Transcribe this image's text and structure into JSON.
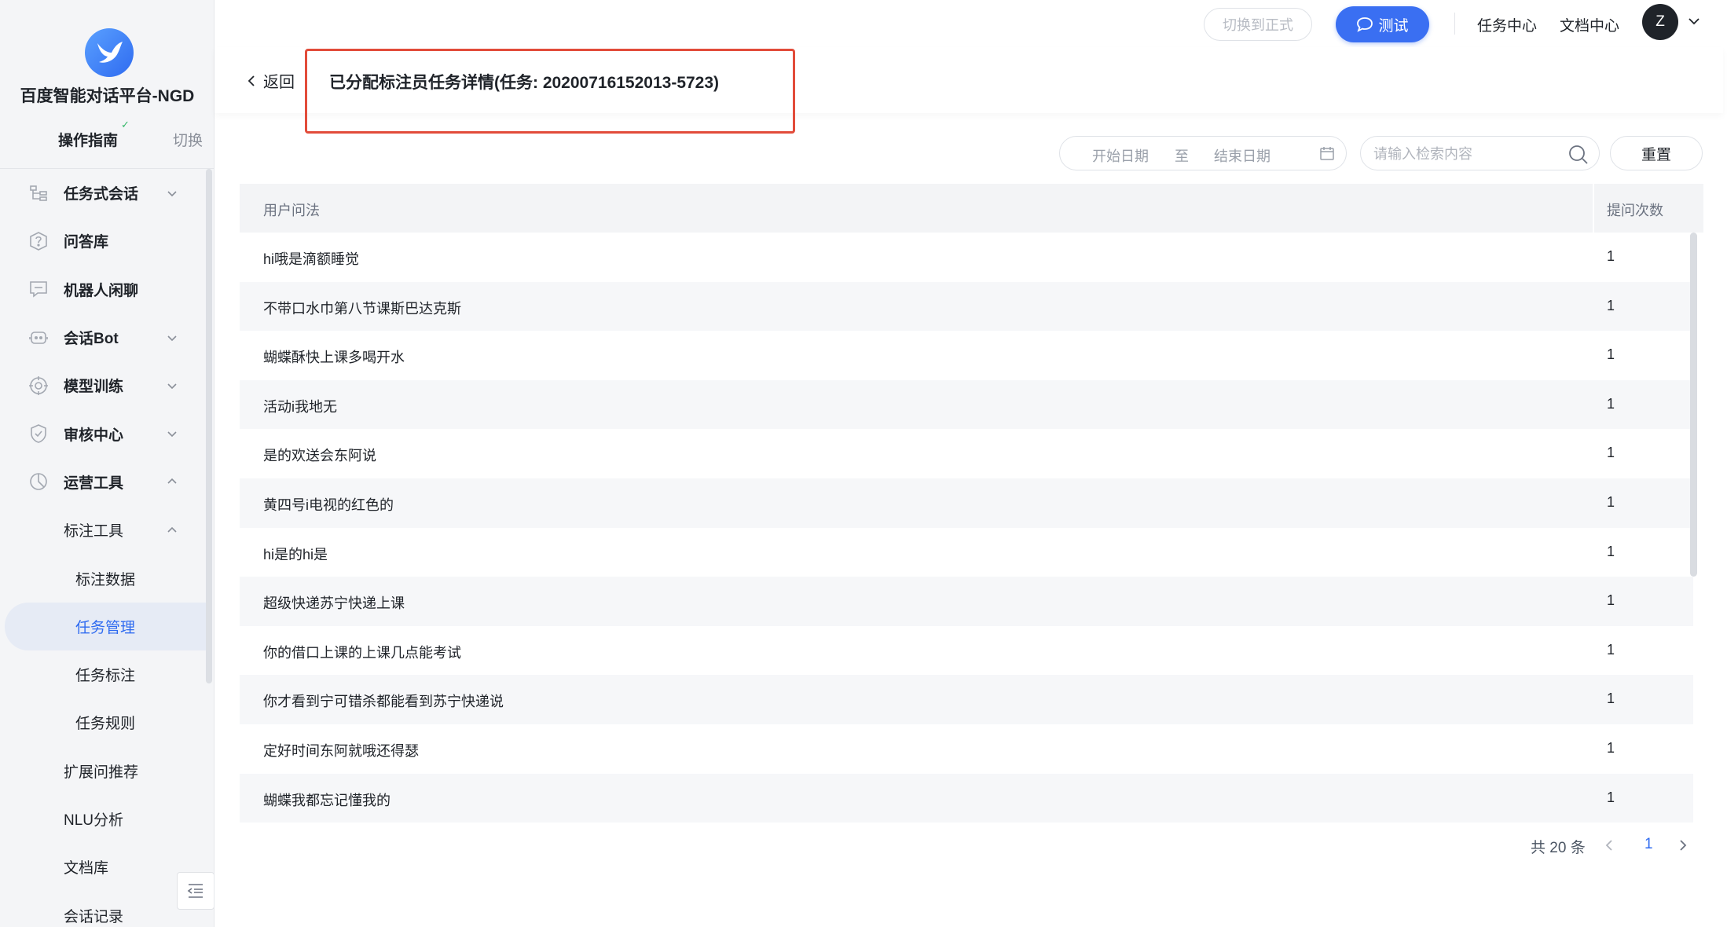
{
  "sidebar": {
    "app_title": "百度智能对话平台-NGD",
    "guide_label": "操作指南",
    "switch_label": "切换",
    "logo_icon": "bird-logo-icon",
    "items": [
      {
        "label": "任务式会话",
        "icon": "tree-icon",
        "expand": "down"
      },
      {
        "label": "问答库",
        "icon": "question-icon",
        "expand": ""
      },
      {
        "label": "机器人闲聊",
        "icon": "chat-icon",
        "expand": ""
      },
      {
        "label": "会话Bot",
        "icon": "bot-icon",
        "expand": "down"
      },
      {
        "label": "模型训练",
        "icon": "target-icon",
        "expand": "down"
      },
      {
        "label": "审核中心",
        "icon": "shield-icon",
        "expand": "down"
      },
      {
        "label": "运营工具",
        "icon": "chart-icon",
        "expand": "up"
      },
      {
        "label": "标注工具",
        "icon": "",
        "expand": "up"
      },
      {
        "label": "标注数据",
        "icon": "",
        "expand": ""
      },
      {
        "label": "任务管理",
        "icon": "",
        "expand": "",
        "active": true
      },
      {
        "label": "任务标注",
        "icon": "",
        "expand": ""
      },
      {
        "label": "任务规则",
        "icon": "",
        "expand": ""
      },
      {
        "label": "扩展问推荐",
        "icon": "",
        "expand": ""
      },
      {
        "label": "NLU分析",
        "icon": "",
        "expand": ""
      },
      {
        "label": "文档库",
        "icon": "",
        "expand": ""
      },
      {
        "label": "会话记录",
        "icon": "",
        "expand": ""
      }
    ]
  },
  "topbar": {
    "switch_label": "切换到正式",
    "test_label": "测试",
    "task_center": "任务中心",
    "doc_center": "文档中心",
    "avatar_letter": "Z"
  },
  "page": {
    "back_label": "返回",
    "title": "已分配标注员任务详情(任务: 20200716152013-5723)"
  },
  "filters": {
    "start_date_placeholder": "开始日期",
    "to_label": "至",
    "end_date_placeholder": "结束日期",
    "search_placeholder": "请输入检索内容",
    "reset_label": "重置"
  },
  "table": {
    "columns": [
      "用户问法",
      "提问次数"
    ],
    "rows": [
      {
        "question": "hi哦是滴额睡觉",
        "count": "1"
      },
      {
        "question": "不带口水巾第八节课斯巴达克斯",
        "count": "1"
      },
      {
        "question": "蝴蝶酥快上课多喝开水",
        "count": "1"
      },
      {
        "question": "活动i我地无",
        "count": "1"
      },
      {
        "question": "是的欢送会东阿说",
        "count": "1"
      },
      {
        "question": "黄四号i电视的红色的",
        "count": "1"
      },
      {
        "question": "hi是的hi是",
        "count": "1"
      },
      {
        "question": "超级快递苏宁快递上课",
        "count": "1"
      },
      {
        "question": "你的借口上课的上课几点能考试",
        "count": "1"
      },
      {
        "question": "你才看到宁可错杀都能看到苏宁快递说",
        "count": "1"
      },
      {
        "question": "定好时间东阿就哦还得瑟",
        "count": "1"
      },
      {
        "question": "蝴蝶我都忘记懂我的",
        "count": "1"
      },
      {
        "question": "",
        "count": ""
      }
    ]
  },
  "pagination": {
    "total_text": "共 20 条",
    "current_page": "1"
  },
  "colors": {
    "accent": "#3a6ff2",
    "highlight_border": "#e24c3a"
  }
}
